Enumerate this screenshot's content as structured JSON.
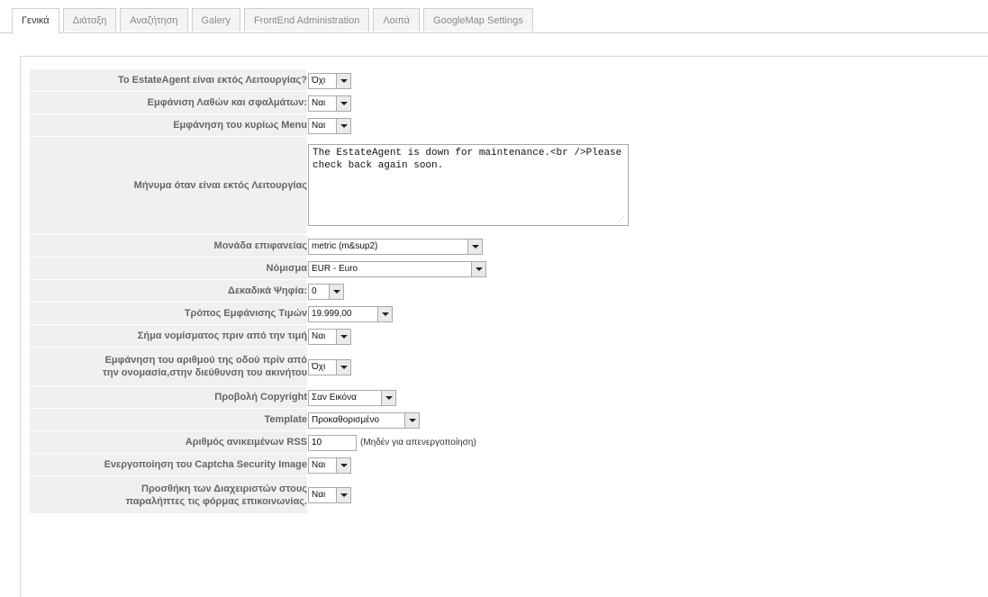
{
  "tabs": [
    {
      "label": "Γενικά",
      "active": true
    },
    {
      "label": "Διάταξη",
      "active": false
    },
    {
      "label": "Αναζήτηση",
      "active": false
    },
    {
      "label": "Galery",
      "active": false
    },
    {
      "label": "FrontEnd Administration",
      "active": false
    },
    {
      "label": "Λοιπά",
      "active": false
    },
    {
      "label": "GoogleMap Settings",
      "active": false
    }
  ],
  "form": {
    "offline": {
      "label": "To EstateAgent είναι εκτός Λειτουργίας?",
      "value": "Όχι"
    },
    "show_errors": {
      "label": "Εμφάνιση Λαθών και σφαλμάτων:",
      "value": "Ναι"
    },
    "show_menu": {
      "label": "Εμφάνηση του κυρίως Menu",
      "value": "Ναι"
    },
    "offline_msg": {
      "label": "Μήνυμα όταν είναι εκτός Λειτουργίας",
      "value": "The EstateAgent is down for maintenance.<br />Please check back again soon."
    },
    "area_unit": {
      "label": "Μονάδα επιφανείας",
      "value": "metric (m&sup2)"
    },
    "currency": {
      "label": "Νόμισμα",
      "value": "EUR - Euro"
    },
    "decimals": {
      "label": "Δεκαδικά Ψηφία:",
      "value": "0"
    },
    "price_format": {
      "label": "Τρόπος Εμφάνισης Τιμών",
      "value": "19.999,00"
    },
    "currency_before": {
      "label": "Σήμα νομίσματος πριν από την τιμή",
      "value": "Ναι"
    },
    "street_number": {
      "label_line1": "Εμφάνηση του αριθμού της οδού πρίν από",
      "label_line2": "την ονομασία,στην διεύθυνση του ακινήτου",
      "value": "Όχι"
    },
    "copyright": {
      "label": "Προβολή Copyright",
      "value": "Σαν Εικόνα"
    },
    "template": {
      "label": "Template",
      "value": "Προκαθορισμένο"
    },
    "rss_items": {
      "label": "Αριθμός ανικειμένων RSS",
      "value": "10",
      "note": "(Μηδέν για απενεργοποίηση)"
    },
    "captcha": {
      "label": "Ενεργοποίηση του Captcha Security Image",
      "value": "Ναι"
    },
    "admins_recipients": {
      "label_line1": "Προσθήκη των Διαχειριστών στους",
      "label_line2": "παραλήπτες τις φόρμας επικοινωνίας.",
      "value": "Ναι"
    }
  }
}
